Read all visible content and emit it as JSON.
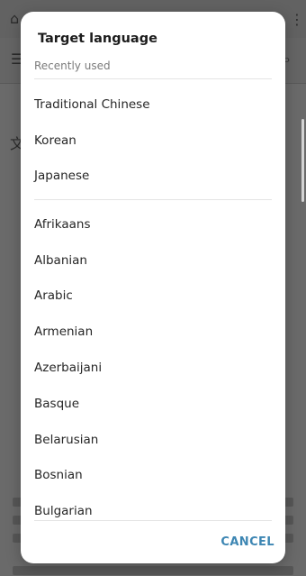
{
  "dialog": {
    "title": "Target language",
    "recent_label": "Recently used",
    "recent_languages": [
      "Traditional Chinese",
      "Korean",
      "Japanese"
    ],
    "all_languages": [
      "Afrikaans",
      "Albanian",
      "Arabic",
      "Armenian",
      "Azerbaijani",
      "Basque",
      "Belarusian",
      "Bosnian",
      "Bulgarian"
    ],
    "cancel_label": "CANCEL"
  },
  "background": {
    "icons": [
      "home-icon",
      "menu-icon",
      "search-icon",
      "translate-icon",
      "more-vert-icon"
    ]
  },
  "colors": {
    "accent": "#3d86b3",
    "dialog_bg": "#ffffff",
    "text_primary": "#262626",
    "text_secondary": "#7b7b7b",
    "scrim": "#6a6a6a"
  }
}
